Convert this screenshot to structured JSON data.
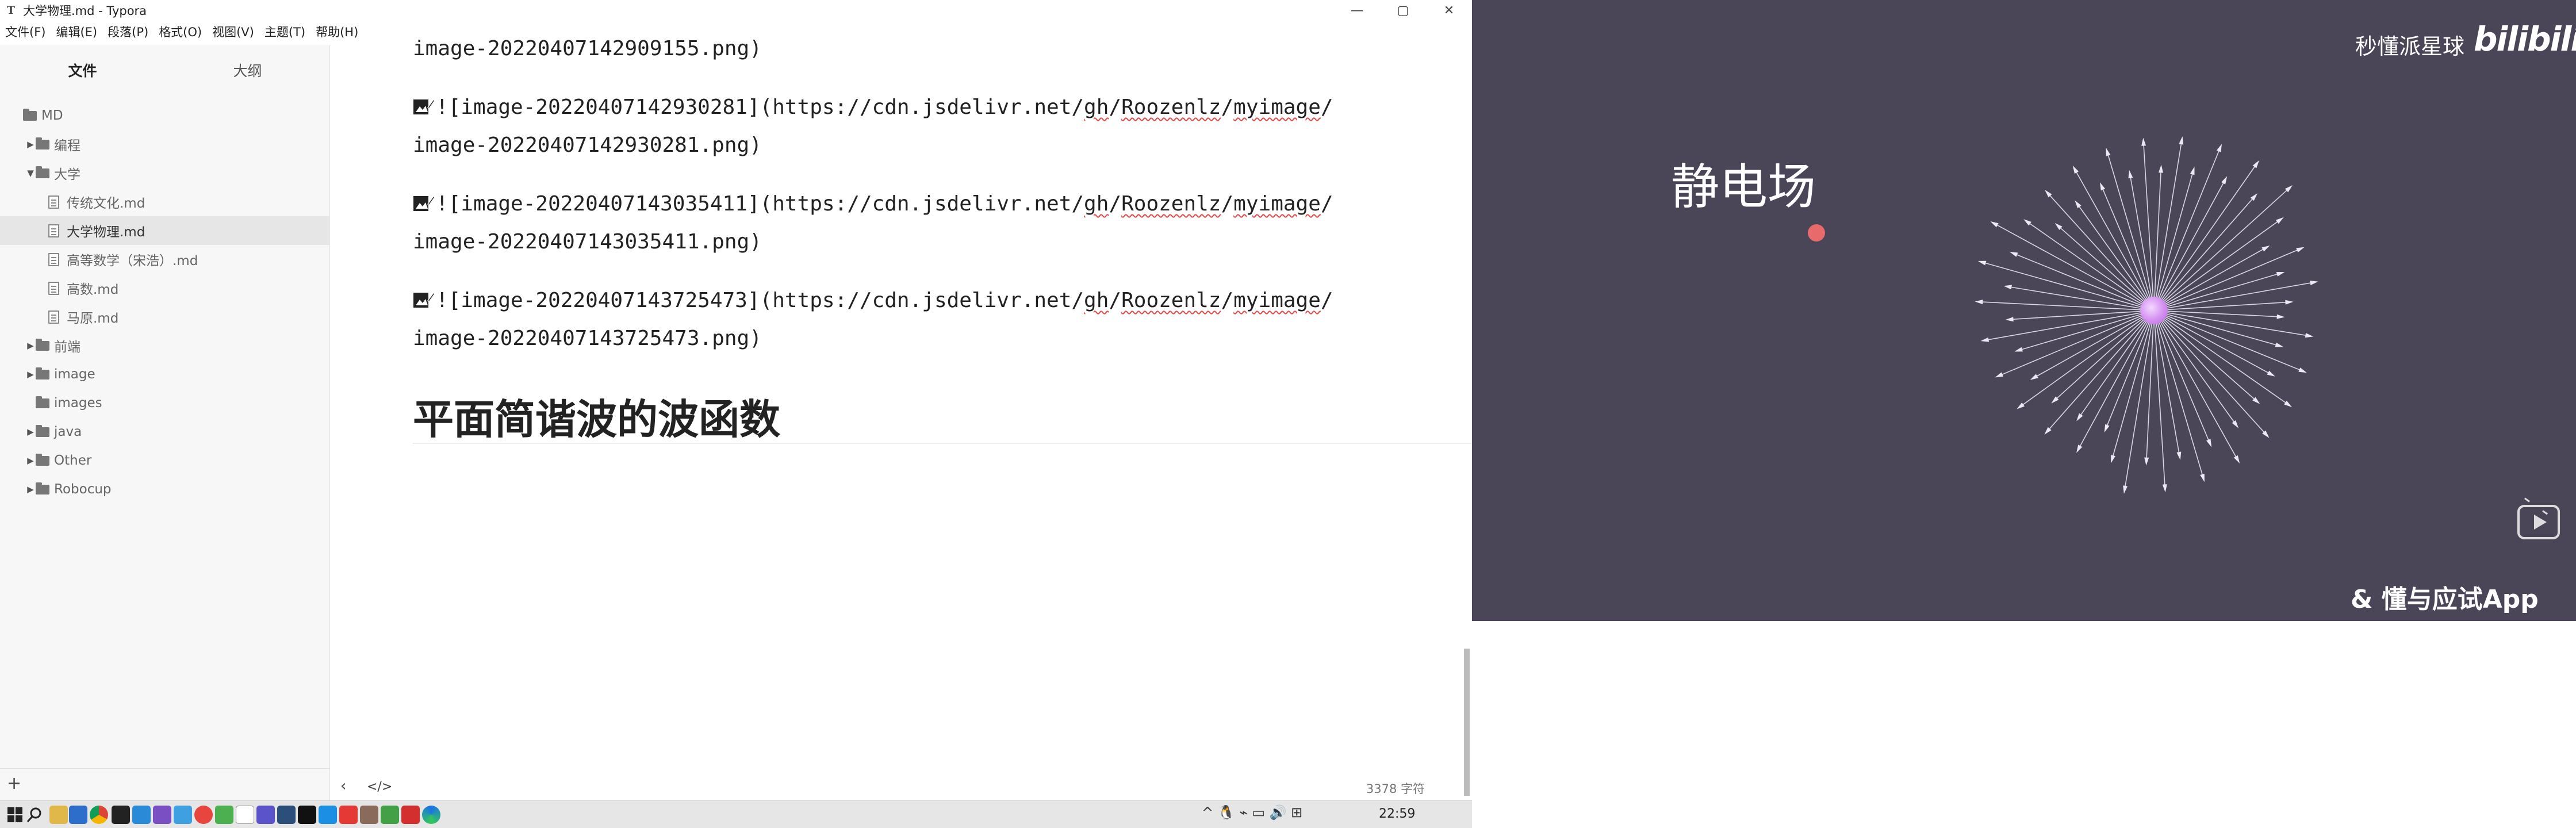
{
  "window": {
    "title": "大学物理.md - Typora",
    "app_icon": "T",
    "buttons": [
      "—",
      "▢",
      "✕"
    ]
  },
  "menu": [
    "文件(F)",
    "编辑(E)",
    "段落(P)",
    "格式(O)",
    "视图(V)",
    "主题(T)",
    "帮助(H)"
  ],
  "sidebar": {
    "tabs": [
      "文件",
      "大纲"
    ],
    "tree": [
      {
        "label": "MD",
        "type": "folder",
        "depth": 0,
        "expanded": true
      },
      {
        "label": "编程",
        "type": "folder",
        "depth": 1,
        "expanded": false
      },
      {
        "label": "大学",
        "type": "folder",
        "depth": 1,
        "expanded": true
      },
      {
        "label": "传统文化.md",
        "type": "file",
        "depth": 2
      },
      {
        "label": "大学物理.md",
        "type": "file",
        "depth": 2,
        "selected": true
      },
      {
        "label": "高等数学（宋浩）.md",
        "type": "file",
        "depth": 2
      },
      {
        "label": "高数.md",
        "type": "file",
        "depth": 2
      },
      {
        "label": "马原.md",
        "type": "file",
        "depth": 2
      },
      {
        "label": "前端",
        "type": "folder",
        "depth": 1,
        "expanded": false
      },
      {
        "label": "image",
        "type": "folder",
        "depth": 1,
        "expanded": false
      },
      {
        "label": "images",
        "type": "folder",
        "depth": 1,
        "leaf": true
      },
      {
        "label": "java",
        "type": "folder",
        "depth": 1,
        "expanded": false
      },
      {
        "label": "Other",
        "type": "folder",
        "depth": 1,
        "expanded": false
      },
      {
        "label": "Robocup",
        "type": "folder",
        "depth": 1,
        "expanded": false
      }
    ],
    "add_label": "+"
  },
  "editor": {
    "first_line": "image-20220407142909155.png)",
    "images": [
      {
        "pre": "![image-20220407142930281](https://cdn.jsdelivr.net/",
        "gh": "gh",
        "user": "Roozenlz",
        "repo": "myimage",
        "file": "image-20220407142930281.png)"
      },
      {
        "pre": "![image-20220407143035411](https://cdn.jsdelivr.net/",
        "gh": "gh",
        "user": "Roozenlz",
        "repo": "myimage",
        "file": "image-20220407143035411.png)"
      },
      {
        "pre": "![image-20220407143725473](https://cdn.jsdelivr.net/",
        "gh": "gh",
        "user": "Roozenlz",
        "repo": "myimage",
        "file": "image-20220407143725473.png)"
      }
    ],
    "heading": "平面简谐波的波函数"
  },
  "status": {
    "back": "‹",
    "source": "</>",
    "wordcount": "3378 字符"
  },
  "video": {
    "title": "静电场",
    "watermark_text": "秒懂派星球",
    "watermark_logo": "bilibili",
    "app_brand": "& 懂与应试App"
  },
  "taskbar": {
    "time": "22:59",
    "tray": "^ 🐧 ⌁ ▭ 🔊 ⊞"
  },
  "colors": {
    "video_bg": "#4a4557",
    "red_dot": "#e86a6a",
    "sphere": "#d48ef0",
    "selected_row": "#e6e6e6"
  }
}
